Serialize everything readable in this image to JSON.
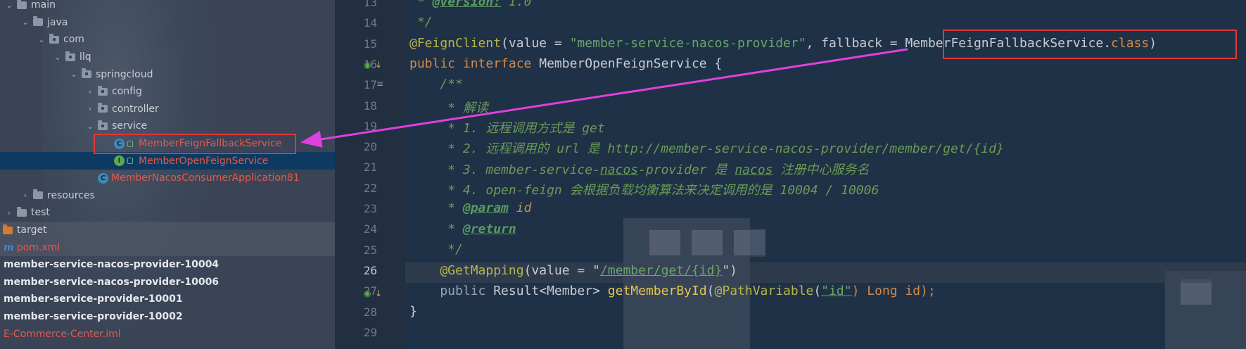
{
  "tree": {
    "rows": [
      {
        "label": "main",
        "indent": 0,
        "chev": "⌄",
        "icon": "folder"
      },
      {
        "label": "java",
        "indent": 1,
        "chev": "⌄",
        "icon": "folder"
      },
      {
        "label": "com",
        "indent": 2,
        "chev": "⌄",
        "icon": "folder-pkg"
      },
      {
        "label": "llq",
        "indent": 3,
        "chev": "⌄",
        "icon": "folder-pkg"
      },
      {
        "label": "springcloud",
        "indent": 4,
        "chev": "⌄",
        "icon": "folder-pkg"
      },
      {
        "label": "config",
        "indent": 5,
        "chev": "›",
        "icon": "folder-pkg"
      },
      {
        "label": "controller",
        "indent": 5,
        "chev": "›",
        "icon": "folder-pkg"
      },
      {
        "label": "service",
        "indent": 5,
        "chev": "⌄",
        "icon": "folder-pkg"
      },
      {
        "label": "MemberFeignFallbackService",
        "indent": 6,
        "chev": "",
        "icon": "class"
      },
      {
        "label": "MemberOpenFeignService",
        "indent": 6,
        "chev": "",
        "icon": "interface"
      },
      {
        "label": "MemberNacosConsumerApplication81",
        "indent": 5,
        "chev": "",
        "icon": "app"
      },
      {
        "label": "resources",
        "indent": 1,
        "chev": "›",
        "icon": "folder"
      },
      {
        "label": "test",
        "indent": 0,
        "chev": "›",
        "icon": "folder"
      },
      {
        "label": "target",
        "indent": -1,
        "chev": "",
        "icon": "folder-orange"
      },
      {
        "label": "pom.xml",
        "indent": -1,
        "chev": "",
        "icon": "maven"
      },
      {
        "label": "member-service-nacos-provider-10004",
        "indent": -2,
        "chev": "",
        "icon": "none"
      },
      {
        "label": "member-service-nacos-provider-10006",
        "indent": -2,
        "chev": "",
        "icon": "none"
      },
      {
        "label": "member-service-provider-10001",
        "indent": -2,
        "chev": "",
        "icon": "none"
      },
      {
        "label": "member-service-provider-10002",
        "indent": -2,
        "chev": "",
        "icon": "none"
      },
      {
        "label": "E-Commerce-Center.iml",
        "indent": -2,
        "chev": "",
        "icon": "none"
      }
    ]
  },
  "editor": {
    "line_numbers": [
      "13",
      "14",
      "15",
      "16",
      "17",
      "18",
      "19",
      "20",
      "21",
      "22",
      "23",
      "24",
      "25",
      "26",
      "27",
      "28",
      "29"
    ],
    "current_line": "26",
    "l13": {
      "star": " * ",
      "tag": "@version:",
      "val": " 1.0"
    },
    "l14": " */",
    "l15": {
      "ann": "@FeignClient",
      "p1": "(value = ",
      "str": "\"member-service-nacos-provider\"",
      "p2": ", fallback = ",
      "cls": "MemberFeignFallbackService",
      "dot": ".",
      "kw": "class",
      "p3": ")"
    },
    "l16": {
      "kw": "public interface ",
      "name": "MemberOpenFeignService",
      "rest": " {"
    },
    "l17": "    /**",
    "l18": "     * 解读",
    "l19": "     * 1. 远程调用方式是 get",
    "l20": "     * 2. 远程调用的 url 是 http://member-service-nacos-provider/member/get/{id}",
    "l21a": "     * 3. member-service-",
    "l21b": "nacos",
    "l21c": "-provider 是 ",
    "l21d": "nacos",
    "l21e": " 注册中心服务名",
    "l22": "     * 4. open-feign 会根据负载均衡算法来决定调用的是 10004 / 10006",
    "l23": {
      "star": "     * ",
      "tag": "@param",
      "val": " id"
    },
    "l24": {
      "star": "     * ",
      "tag": "@return"
    },
    "l25": "     */",
    "l26": {
      "ann": "    @GetMapping",
      "p1": "(value = \"",
      "path": "/member/get/{id}",
      "p2": "\")"
    },
    "l27": {
      "kw": "    public ",
      "type": "Result<Member> ",
      "fn": "getMemberById",
      "p1": "(",
      "ann": "@PathVariable",
      "p2": "(",
      "str": "\"id\"",
      "p3": ") Long id);"
    },
    "l28": "}",
    "l29": ""
  },
  "colors": {
    "highlight_box": "#e0373a",
    "arrow": "#e040e0"
  }
}
